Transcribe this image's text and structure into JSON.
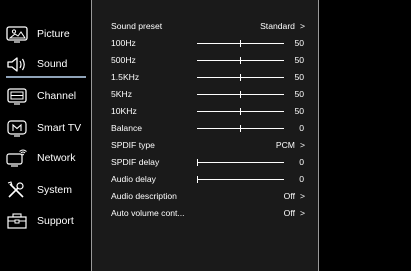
{
  "sidebar": {
    "items": [
      {
        "label": "Picture",
        "icon": "picture-icon"
      },
      {
        "label": "Sound",
        "icon": "speaker-icon",
        "active": true
      },
      {
        "label": "Channel",
        "icon": "channel-icon"
      },
      {
        "label": "Smart TV",
        "icon": "smart-tv-icon"
      },
      {
        "label": "Network",
        "icon": "network-icon"
      },
      {
        "label": "System",
        "icon": "system-tools-icon"
      },
      {
        "label": "Support",
        "icon": "support-toolbox-icon"
      }
    ]
  },
  "sound": {
    "sound_preset": {
      "label": "Sound preset",
      "value": "Standard",
      "arrow": ">"
    },
    "eq_100": {
      "label": "100Hz",
      "value": "50",
      "level": 0.5
    },
    "eq_500": {
      "label": "500Hz",
      "value": "50",
      "level": 0.5
    },
    "eq_1500": {
      "label": "1.5KHz",
      "value": "50",
      "level": 0.5
    },
    "eq_5000": {
      "label": "5KHz",
      "value": "50",
      "level": 0.5
    },
    "eq_10000": {
      "label": "10KHz",
      "value": "50",
      "level": 0.5
    },
    "balance": {
      "label": "Balance",
      "value": "0",
      "level": 0.5
    },
    "spdif_type": {
      "label": "SPDIF type",
      "value": "PCM",
      "arrow": ">"
    },
    "spdif_delay": {
      "label": "SPDIF delay",
      "value": "0",
      "level": 0
    },
    "audio_delay": {
      "label": "Audio delay",
      "value": "0",
      "level": 0
    },
    "audio_description": {
      "label": "Audio description",
      "value": "Off",
      "arrow": ">"
    },
    "auto_volume": {
      "label": "Auto volume cont...",
      "value": "Off",
      "arrow": ">"
    }
  }
}
